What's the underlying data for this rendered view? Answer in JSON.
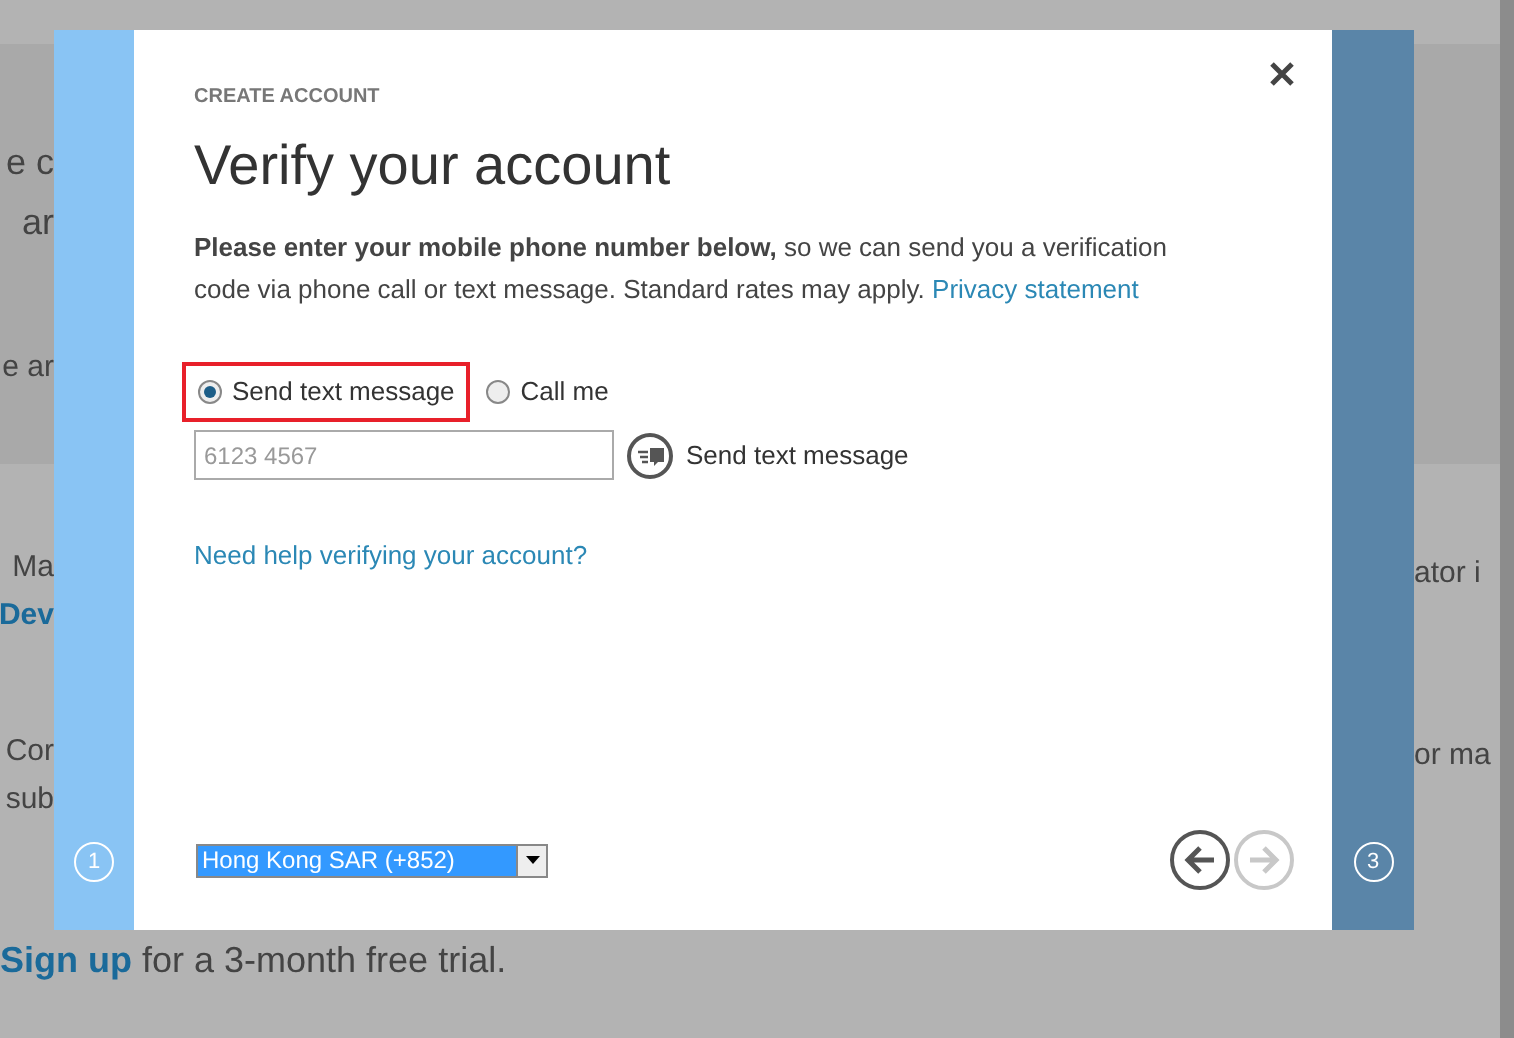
{
  "background": {
    "left_fragments": [
      {
        "text": "e c",
        "kind": "heading"
      },
      {
        "text": "ar",
        "kind": "heading"
      },
      {
        "text": "e ar",
        "kind": "subheading"
      },
      {
        "text": "Ma",
        "kind": "body"
      },
      {
        "text": "Dev",
        "kind": "link"
      },
      {
        "text": "Cor",
        "kind": "body"
      },
      {
        "text": "sub",
        "kind": "body"
      }
    ],
    "right_fragments": [
      {
        "text": "ator i",
        "kind": "body"
      },
      {
        "text": "or ma",
        "kind": "body"
      }
    ],
    "signup": {
      "link": "Sign up",
      "text": " for a 3-month free trial."
    }
  },
  "dialog": {
    "eyebrow": "CREATE ACCOUNT",
    "title": "Verify your account",
    "intro": "**Please enter your mobile phone number below,** so we can send you a verification code via phone call or text message. Standard rates may apply.",
    "privacy_link": "Privacy statement",
    "options": [
      {
        "label": "Send text message",
        "selected": true,
        "highlighted": true
      },
      {
        "label": "Call me",
        "selected": false,
        "highlighted": false
      }
    ],
    "phone": {
      "placeholder": "6123 4567"
    },
    "send_button": "Send text message",
    "help_link": "Need help verifying your account?",
    "country": "Hong Kong SAR (+852)",
    "back": {
      "disabled": false
    },
    "next": {
      "disabled": true
    },
    "steps": [
      "1",
      "3"
    ]
  }
}
